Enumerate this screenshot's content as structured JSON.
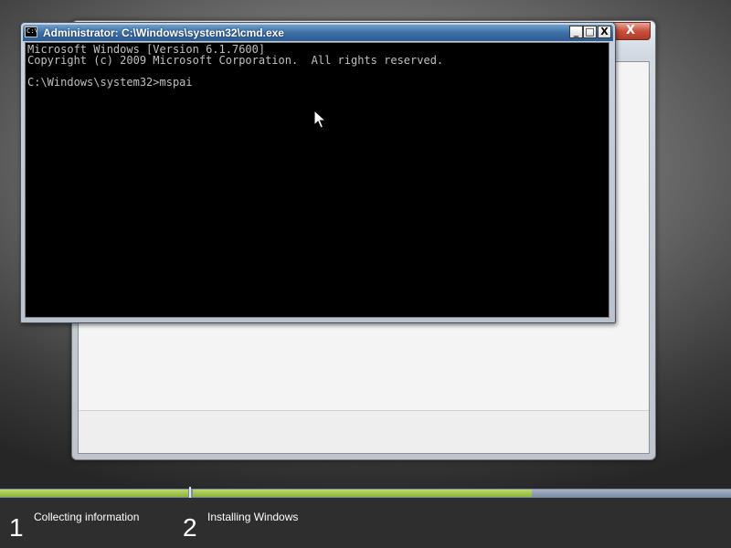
{
  "setup_window": {
    "close_glyph": "X"
  },
  "cmd_window": {
    "icon_text": "C:\\",
    "title": "Administrator: C:\\Windows\\system32\\cmd.exe",
    "minimize_glyph": "_",
    "maximize_glyph": "□",
    "close_glyph": "X",
    "console_lines": [
      "Microsoft Windows [Version 6.1.7600]",
      "Copyright (c) 2009 Microsoft Corporation.  All rights reserved.",
      "",
      "C:\\Windows\\system32>mspai"
    ],
    "colors": {
      "console_bg": "#000000",
      "console_text": "#c0c0c0"
    }
  },
  "progress": {
    "fraction_complete": 0.73,
    "colors": {
      "done": "#8cb43a",
      "remaining": "#7f8fa8"
    }
  },
  "steps": [
    {
      "number": "1",
      "label": "Collecting information"
    },
    {
      "number": "2",
      "label": "Installing Windows"
    }
  ],
  "icons": {
    "cursor": "arrow-cursor-icon",
    "cmd": "cmd-app-icon"
  }
}
